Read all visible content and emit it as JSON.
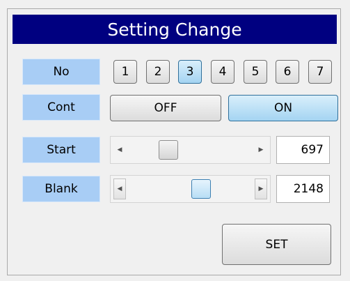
{
  "title": "Setting Change",
  "labels": {
    "no": "No",
    "cont": "Cont",
    "start": "Start",
    "blank": "Blank"
  },
  "number_buttons": [
    {
      "label": "1",
      "selected": false
    },
    {
      "label": "2",
      "selected": false
    },
    {
      "label": "3",
      "selected": true
    },
    {
      "label": "4",
      "selected": false
    },
    {
      "label": "5",
      "selected": false
    },
    {
      "label": "6",
      "selected": false
    },
    {
      "label": "7",
      "selected": false
    }
  ],
  "cont": {
    "off_label": "OFF",
    "on_label": "ON",
    "selected": "ON"
  },
  "start": {
    "value": "697",
    "slider_fraction": 0.3
  },
  "blank": {
    "value": "2148",
    "slider_fraction": 0.6
  },
  "set_button": "SET",
  "colors": {
    "title_bg": "#000080",
    "label_bg": "#a8cdf5",
    "active_button": "#a4d4f2"
  },
  "icons": {
    "left_arrow": "left-arrow-icon",
    "right_arrow": "right-arrow-icon"
  }
}
